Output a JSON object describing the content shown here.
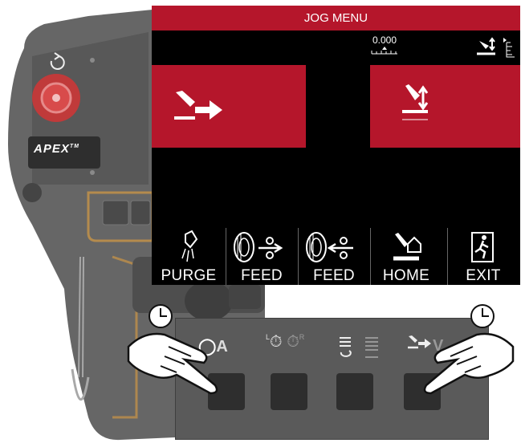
{
  "screen": {
    "title": "JOG MENU",
    "position_readout": "0.000",
    "softkeys": [
      {
        "label": "PURGE",
        "icon": "purge-icon"
      },
      {
        "label": "FEED",
        "icon": "wire-feed-forward-icon"
      },
      {
        "label": "FEED",
        "icon": "wire-feed-reverse-icon"
      },
      {
        "label": "HOME",
        "icon": "home-icon"
      },
      {
        "label": "EXIT",
        "icon": "exit-icon"
      }
    ]
  },
  "pendant": {
    "brand": "APEX",
    "brand_tm": "TM"
  },
  "keypad": {
    "key1_label": "A",
    "key2_sup_l": "L",
    "key2_sup_r": "R",
    "key4_label": "V"
  },
  "colors": {
    "accent_red": "#b5162b",
    "screen_bg": "#000000",
    "pendant_gray": "#5b5b5b",
    "highlight_orange": "#e8a33c"
  }
}
